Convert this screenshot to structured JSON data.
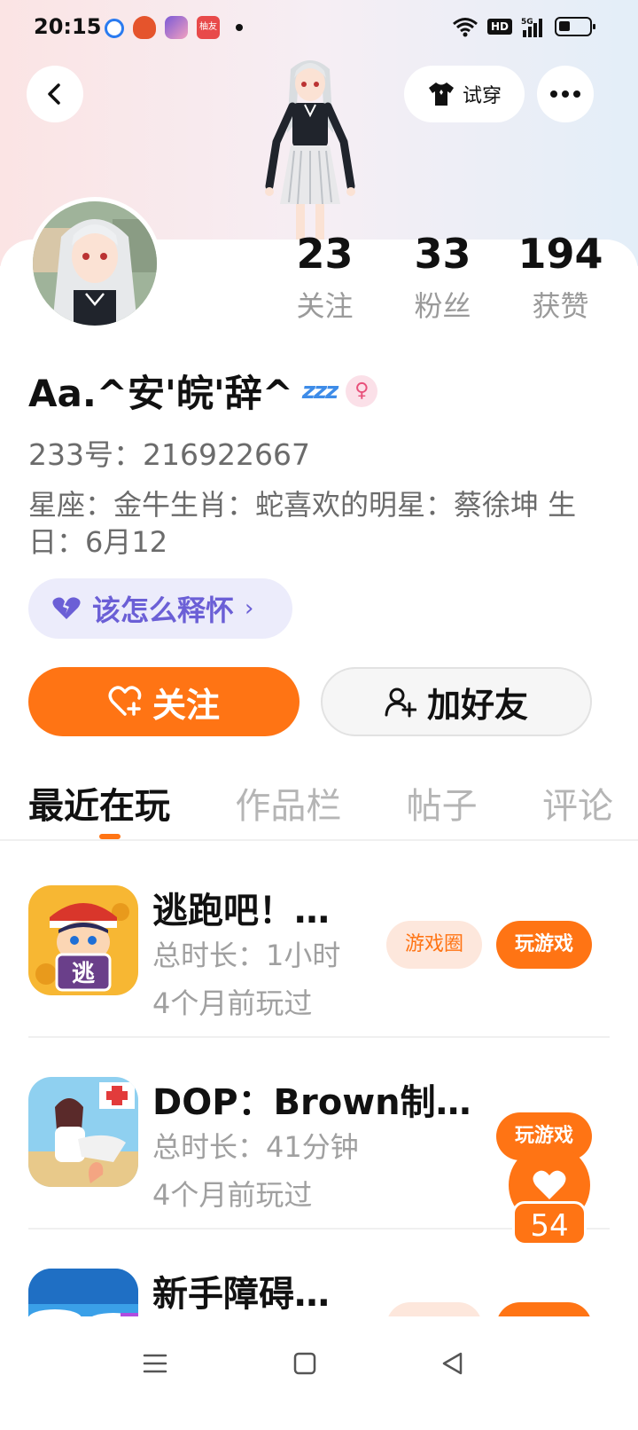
{
  "status_bar": {
    "time": "20:15",
    "notif4_label": "柚友",
    "network": "5G",
    "hd": "HD"
  },
  "header": {
    "tryon_label": "试穿"
  },
  "profile": {
    "stats": [
      {
        "value": "23",
        "label": "关注"
      },
      {
        "value": "33",
        "label": "粉丝"
      },
      {
        "value": "194",
        "label": "获赞"
      }
    ],
    "name": "Aa.^安'皖'辞^",
    "zzz": "zzz",
    "gender_symbol": "♀",
    "id_line": "233号：216922667",
    "bio": "星座：金牛生肖：蛇喜欢的明星：蔡徐坤  生日：6月12",
    "mood": "该怎么释怀",
    "mood_chevron": "›"
  },
  "actions": {
    "follow": "关注",
    "add_friend": "加好友"
  },
  "tabs": [
    {
      "label": "最近在玩",
      "active": true
    },
    {
      "label": "作品栏"
    },
    {
      "label": "帖子"
    },
    {
      "label": "评论"
    }
  ],
  "games": [
    {
      "title": "逃跑吧！…",
      "duration": "总时长：1小时",
      "last_played": "4个月前玩过",
      "circle_label": "游戏圈",
      "play_label": "玩游戏",
      "icon_char": "逃"
    },
    {
      "title": "DOP：Brown制…",
      "duration": "总时长：41分钟",
      "last_played": "4个月前玩过",
      "play_label": "玩游戏"
    },
    {
      "title": "新手障碍…"
    }
  ],
  "like": {
    "count": "54"
  },
  "colors": {
    "accent": "#ff7414",
    "mood_bg": "#ececfb",
    "mood_text": "#6b5fd6"
  }
}
